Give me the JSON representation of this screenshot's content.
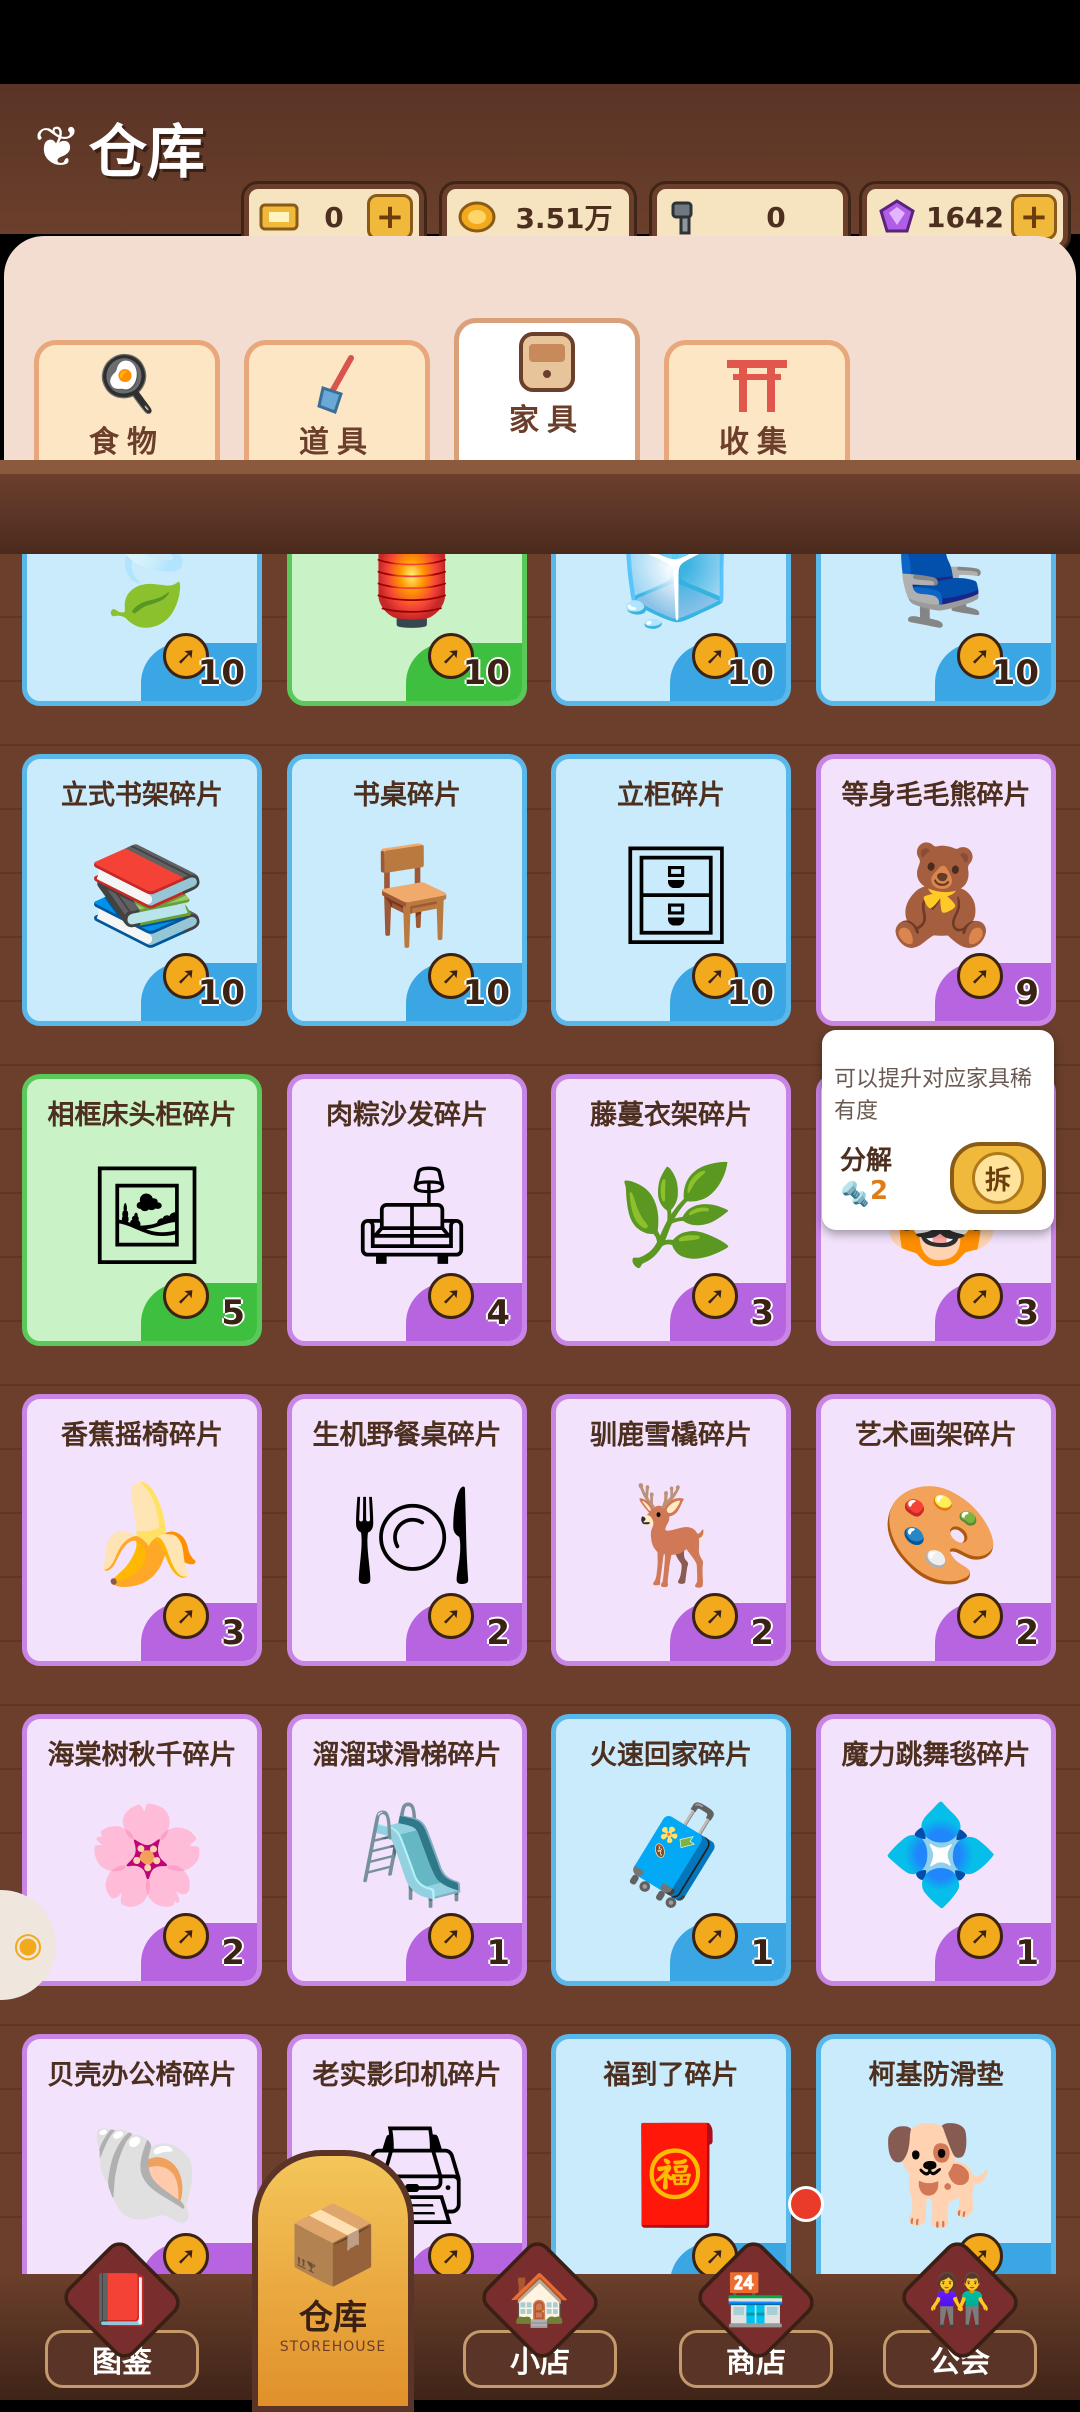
{
  "header": {
    "title": "仓库",
    "currencies": [
      {
        "icon": "ticket-icon",
        "value": "0",
        "has_plus": true
      },
      {
        "icon": "coin-icon",
        "value": "3.51万",
        "has_plus": false
      },
      {
        "icon": "bolt-icon",
        "value": "0",
        "has_plus": false
      },
      {
        "icon": "gem-icon",
        "value": "1642",
        "has_plus": true
      }
    ]
  },
  "tabs": [
    {
      "label": "食物",
      "icon": "egg-icon",
      "active": false
    },
    {
      "label": "道具",
      "icon": "shovel-icon",
      "active": false
    },
    {
      "label": "家具",
      "icon": "cabinet-icon",
      "active": true
    },
    {
      "label": "收集",
      "icon": "torii-icon",
      "active": false
    }
  ],
  "items": [
    {
      "name": "",
      "count": "10",
      "color": "blue",
      "icon": "leaf-icon",
      "glyph": "🍃"
    },
    {
      "name": "",
      "count": "10",
      "color": "green",
      "icon": "lamp-icon",
      "glyph": "🏮"
    },
    {
      "name": "",
      "count": "10",
      "color": "blue",
      "icon": "fridge-icon",
      "glyph": "🧊"
    },
    {
      "name": "",
      "count": "10",
      "color": "blue",
      "icon": "chair-icon",
      "glyph": "💺"
    },
    {
      "name": "立式书架碎片",
      "count": "10",
      "color": "blue",
      "icon": "bookshelf-icon",
      "glyph": "📚"
    },
    {
      "name": "书桌碎片",
      "count": "10",
      "color": "blue",
      "icon": "desk-icon",
      "glyph": "🪑"
    },
    {
      "name": "立柜碎片",
      "count": "10",
      "color": "blue",
      "icon": "cabinet-icon",
      "glyph": "🗄"
    },
    {
      "name": "等身毛毛熊碎片",
      "count": "9",
      "color": "purple",
      "icon": "teddy-bear-icon",
      "glyph": "🧸"
    },
    {
      "name": "相框床头柜碎片",
      "count": "5",
      "color": "green",
      "icon": "nightstand-icon",
      "glyph": "🖼"
    },
    {
      "name": "肉粽沙发碎片",
      "count": "4",
      "color": "purple",
      "icon": "sofa-icon",
      "glyph": "🛋"
    },
    {
      "name": "藤蔓衣架碎片",
      "count": "3",
      "color": "purple",
      "icon": "coat-rack-icon",
      "glyph": "🌿"
    },
    {
      "name": "",
      "count": "3",
      "color": "purple",
      "icon": "tiger-icon",
      "glyph": "🐯"
    },
    {
      "name": "香蕉摇椅碎片",
      "count": "3",
      "color": "purple",
      "icon": "rocking-chair-icon",
      "glyph": "🍌"
    },
    {
      "name": "生机野餐桌碎片",
      "count": "2",
      "color": "purple",
      "icon": "picnic-table-icon",
      "glyph": "🍽"
    },
    {
      "name": "驯鹿雪橇碎片",
      "count": "2",
      "color": "purple",
      "icon": "sleigh-icon",
      "glyph": "🦌"
    },
    {
      "name": "艺术画架碎片",
      "count": "2",
      "color": "purple",
      "icon": "easel-icon",
      "glyph": "🎨"
    },
    {
      "name": "海棠树秋千碎片",
      "count": "2",
      "color": "purple",
      "icon": "swing-tree-icon",
      "glyph": "🌸"
    },
    {
      "name": "溜溜球滑梯碎片",
      "count": "1",
      "color": "purple",
      "icon": "slide-icon",
      "glyph": "🛝"
    },
    {
      "name": "火速回家碎片",
      "count": "1",
      "color": "blue",
      "icon": "suitcase-icon",
      "glyph": "🧳"
    },
    {
      "name": "魔力跳舞毯碎片",
      "count": "1",
      "color": "purple",
      "icon": "dance-mat-icon",
      "glyph": "💠"
    },
    {
      "name": "贝壳办公椅碎片",
      "count": "",
      "color": "purple",
      "icon": "shell-chair-icon",
      "glyph": "🐚"
    },
    {
      "name": "老实影印机碎片",
      "count": "",
      "color": "purple",
      "icon": "copier-icon",
      "glyph": "🖨"
    },
    {
      "name": "福到了碎片",
      "count": "",
      "color": "blue",
      "icon": "fortune-sign-icon",
      "glyph": "🧧"
    },
    {
      "name": "柯基防滑垫",
      "count": "",
      "color": "blue",
      "icon": "corgi-mat-icon",
      "glyph": "🐕"
    }
  ],
  "tooltip": {
    "description": "可以提升对应家具稀有度",
    "action_label": "分解",
    "cost": "2",
    "button_label": "拆"
  },
  "nav": {
    "items": [
      {
        "label": "图鉴",
        "icon": "album-icon",
        "glyph": "📕"
      },
      {
        "label": "小店",
        "icon": "shop-house-icon",
        "glyph": "🏠"
      },
      {
        "label": "商店",
        "icon": "store-icon",
        "glyph": "🏪"
      },
      {
        "label": "公会",
        "icon": "guild-icon",
        "glyph": "👫"
      }
    ],
    "active": {
      "label": "仓库",
      "sublabel": "STOREHOUSE",
      "icon": "storehouse-icon",
      "glyph": "📦"
    }
  }
}
